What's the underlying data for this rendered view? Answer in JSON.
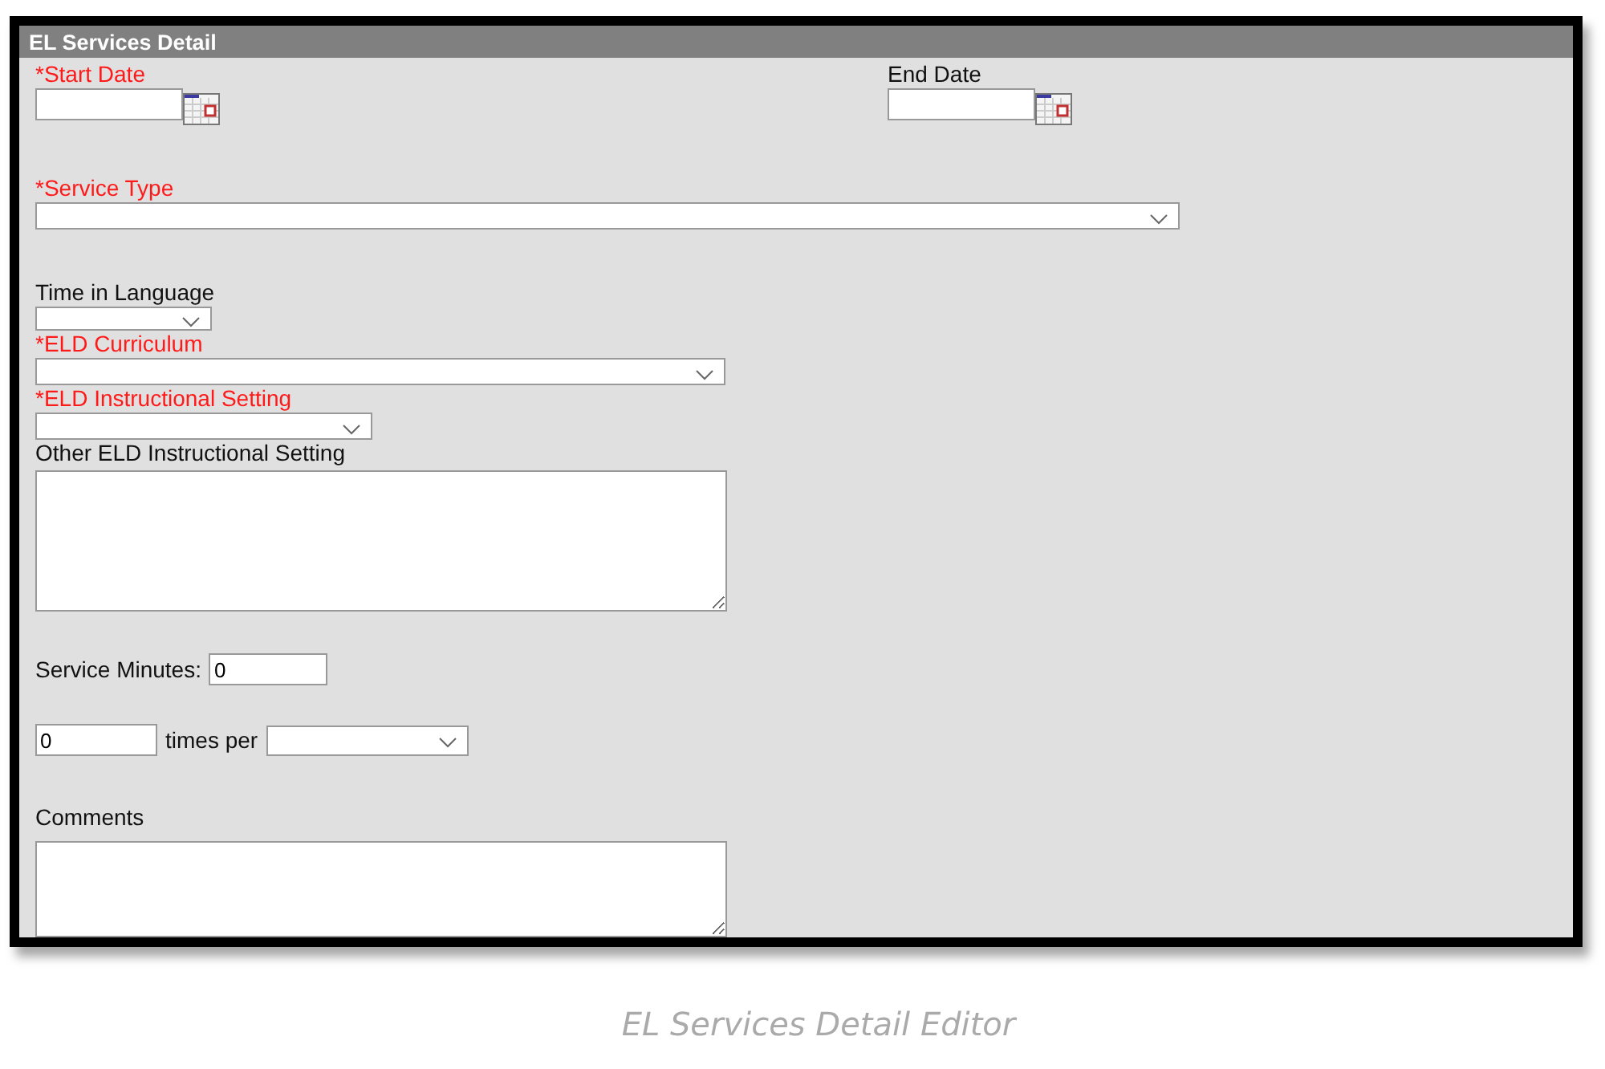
{
  "panel": {
    "title": "EL Services Detail"
  },
  "start_date": {
    "label": "*Start Date",
    "required": true
  },
  "end_date": {
    "label": "End Date",
    "required": false
  },
  "service_type": {
    "label": "*Service Type",
    "required": true
  },
  "time_in_language": {
    "label": "Time in Language",
    "required": false
  },
  "eld_curriculum": {
    "label": "*ELD Curriculum",
    "required": true
  },
  "eld_instructional_setting": {
    "label": "*ELD Instructional Setting",
    "required": true
  },
  "other_eld_instructional_setting": {
    "label": "Other ELD Instructional Setting",
    "required": false
  },
  "service_minutes": {
    "label": "Service Minutes:",
    "value": "0"
  },
  "frequency": {
    "value": "0",
    "label": "times per"
  },
  "comments": {
    "label": "Comments",
    "required": false
  },
  "caption": "EL Services Detail Editor"
}
